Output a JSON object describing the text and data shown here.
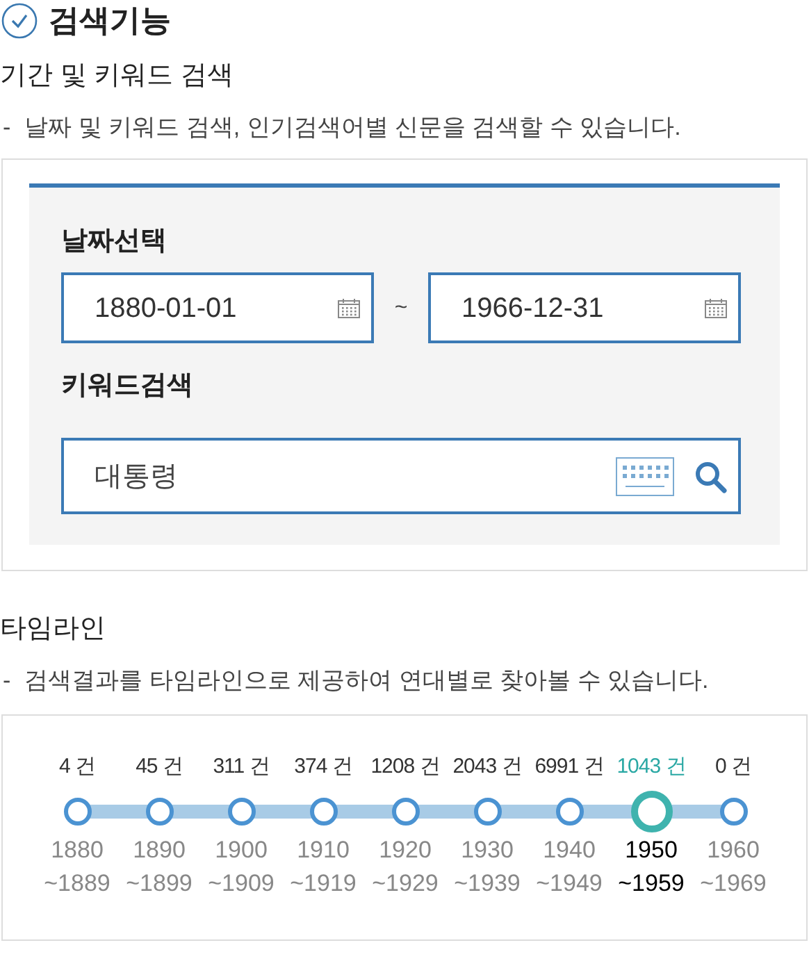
{
  "title": "검색기능",
  "search_section": {
    "heading": "기간 및 키워드 검색",
    "bullet": "-",
    "description": "날짜 및 키워드 검색, 인기검색어별 신문을 검색할 수 있습니다.",
    "date_label": "날짜선택",
    "date_from": "1880-01-01",
    "separator": "~",
    "date_to": "1966-12-31",
    "keyword_label": "키워드검색",
    "keyword": "대통령"
  },
  "timeline_section": {
    "heading": "타임라인",
    "bullet": "-",
    "description": "검색결과를 타임라인으로 제공하여 연대별로 찾아볼 수 있습니다.",
    "periods": [
      {
        "count": "4 건",
        "start": "1880",
        "end": "~1889",
        "selected": false
      },
      {
        "count": "45 건",
        "start": "1890",
        "end": "~1899",
        "selected": false
      },
      {
        "count": "311 건",
        "start": "1900",
        "end": "~1909",
        "selected": false
      },
      {
        "count": "374 건",
        "start": "1910",
        "end": "~1919",
        "selected": false
      },
      {
        "count": "1208 건",
        "start": "1920",
        "end": "~1929",
        "selected": false
      },
      {
        "count": "2043 건",
        "start": "1930",
        "end": "~1939",
        "selected": false
      },
      {
        "count": "6991 건",
        "start": "1940",
        "end": "~1949",
        "selected": false
      },
      {
        "count": "1043 건",
        "start": "1950",
        "end": "~1959",
        "selected": true
      },
      {
        "count": "0 건",
        "start": "1960",
        "end": "~1969",
        "selected": false
      }
    ]
  }
}
